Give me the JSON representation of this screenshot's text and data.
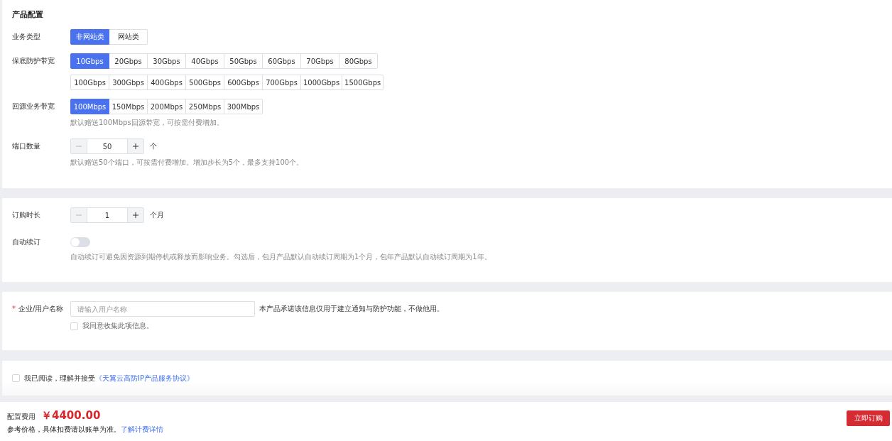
{
  "product_config": {
    "title": "产品配置",
    "business_type": {
      "label": "业务类型",
      "options": [
        {
          "label": "非网站类",
          "selected": true
        },
        {
          "label": "网站类",
          "selected": false
        }
      ]
    },
    "protection_bandwidth": {
      "label": "保底防护带宽",
      "rows": [
        {
          "options": [
            {
              "label": "10Gbps",
              "selected": true
            },
            {
              "label": "20Gbps",
              "selected": false
            },
            {
              "label": "30Gbps",
              "selected": false
            },
            {
              "label": "40Gbps",
              "selected": false
            },
            {
              "label": "50Gbps",
              "selected": false
            },
            {
              "label": "60Gbps",
              "selected": false
            },
            {
              "label": "70Gbps",
              "selected": false
            },
            {
              "label": "80Gbps",
              "selected": false
            }
          ]
        },
        {
          "options": [
            {
              "label": "100Gbps",
              "selected": false
            },
            {
              "label": "300Gbps",
              "selected": false
            },
            {
              "label": "400Gbps",
              "selected": false
            },
            {
              "label": "500Gbps",
              "selected": false
            },
            {
              "label": "600Gbps",
              "selected": false
            },
            {
              "label": "700Gbps",
              "selected": false
            },
            {
              "label": "1000Gbps",
              "selected": false
            },
            {
              "label": "1500Gbps",
              "selected": false
            }
          ]
        }
      ]
    },
    "return_bandwidth": {
      "label": "回源业务带宽",
      "options": [
        {
          "label": "100Mbps",
          "selected": true
        },
        {
          "label": "150Mbps",
          "selected": false
        },
        {
          "label": "200Mbps",
          "selected": false
        },
        {
          "label": "250Mbps",
          "selected": false
        },
        {
          "label": "300Mbps",
          "selected": false
        }
      ],
      "hint": "默认赠送100Mbps回源带宽，可按需付费增加。"
    },
    "ports": {
      "label": "端口数量",
      "value": "50",
      "unit": "个",
      "hint": "默认赠送50个端口，可按需付费增加。增加步长为5个，最多支持100个。"
    }
  },
  "subscription": {
    "duration": {
      "label": "订购时长",
      "value": "1",
      "unit": "个月"
    },
    "auto_renew": {
      "label": "自动续订",
      "on": false,
      "hint": "自动续订可避免因资源到期停机或释放而影响业务。勾选后，包月产品默认自动续订周期为1个月，包年产品默认自动续订周期为1年。"
    }
  },
  "user_info": {
    "label": "企业/用户名称",
    "required_mark": "*",
    "placeholder": "请输入用户名称",
    "note": "本产品承诺该信息仅用于建立通知与防护功能，不做他用。",
    "consent": {
      "label": "我同意收集此项信息。",
      "checked": false
    }
  },
  "agreement": {
    "checked": false,
    "text": "我已阅读，理解并接受",
    "link": "《天翼云高防IP产品服务协议》"
  },
  "footer": {
    "label": "配置费用",
    "price": "￥4400.00",
    "note": "参考价格，具体扣费请以账单为准。",
    "link": "了解计费详情",
    "button": "立即订购"
  }
}
